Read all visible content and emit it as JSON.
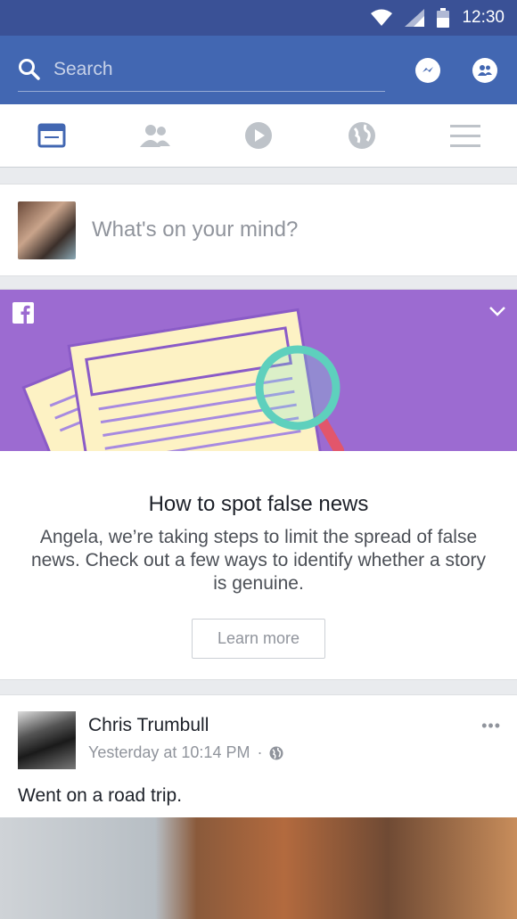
{
  "status_bar": {
    "time": "12:30",
    "icons": [
      "wifi-icon",
      "signal-icon",
      "battery-icon"
    ]
  },
  "top_bar": {
    "search_placeholder": "Search",
    "icons": [
      "messenger-icon",
      "friends-icon"
    ]
  },
  "tabs": [
    {
      "name": "news-feed",
      "icon": "news-feed-icon",
      "active": true
    },
    {
      "name": "friends",
      "icon": "friends-icon",
      "active": false
    },
    {
      "name": "watch",
      "icon": "play-icon",
      "active": false
    },
    {
      "name": "notifications",
      "icon": "globe-icon",
      "active": false
    },
    {
      "name": "menu",
      "icon": "menu-icon",
      "active": false
    }
  ],
  "composer": {
    "placeholder": "What's on your mind?"
  },
  "promo": {
    "title": "How to spot false news",
    "text": "Angela, we’re taking steps to limit the spread of false news. Check out a few ways to identify whether a story is genuine.",
    "button_label": "Learn more"
  },
  "post": {
    "author": "Chris Trumbull",
    "time": "Yesterday at 10:14 PM",
    "separator": "·",
    "text": "Went on a road trip."
  },
  "colors": {
    "brand": "#4267b2",
    "status": "#3a5196",
    "promo_bg": "#9c6bd1"
  }
}
